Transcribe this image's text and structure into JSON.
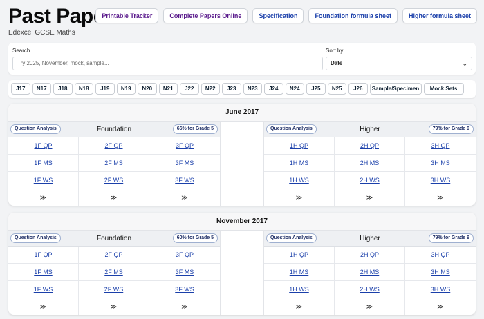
{
  "header": {
    "title": "Past Papers",
    "subtitle": "Edexcel GCSE Maths"
  },
  "top_links": [
    {
      "label": "Printable Tracker",
      "state": "visited"
    },
    {
      "label": "Complete Papers Online",
      "state": "visited"
    },
    {
      "label": "Specification",
      "state": "link"
    },
    {
      "label": "Foundation formula sheet",
      "state": "link"
    },
    {
      "label": "Higher formula sheet",
      "state": "link"
    }
  ],
  "search": {
    "label": "Search",
    "placeholder": "Try 2025, November, mock, sample..."
  },
  "sort": {
    "label": "Sort by",
    "value": "Date"
  },
  "chips": [
    "J17",
    "N17",
    "J18",
    "N18",
    "J19",
    "N19",
    "N20",
    "N21",
    "J22",
    "N22",
    "J23",
    "N23",
    "J24",
    "N24",
    "J25",
    "N25",
    "J26",
    "Sample/Specimen",
    "Mock Sets"
  ],
  "sessions": [
    {
      "title": "June 2017",
      "foundation": {
        "name": "Foundation",
        "analysis": "Question Analysis",
        "grade": "66% for Grade 5",
        "rows": [
          [
            "1F QP",
            "2F QP",
            "3F QP"
          ],
          [
            "1F MS",
            "2F MS",
            "3F MS"
          ],
          [
            "1F WS",
            "2F WS",
            "3F WS"
          ],
          [
            "≫",
            "≫",
            "≫"
          ]
        ]
      },
      "higher": {
        "name": "Higher",
        "analysis": "Question Analysis",
        "grade": "79% for Grade 9",
        "rows": [
          [
            "1H QP",
            "2H QP",
            "3H QP"
          ],
          [
            "1H MS",
            "2H MS",
            "3H MS"
          ],
          [
            "1H WS",
            "2H WS",
            "3H WS"
          ],
          [
            "≫",
            "≫",
            "≫"
          ]
        ]
      }
    },
    {
      "title": "November 2017",
      "foundation": {
        "name": "Foundation",
        "analysis": "Question Analysis",
        "grade": "60% for Grade 5",
        "rows": [
          [
            "1F QP",
            "2F QP",
            "3F QP"
          ],
          [
            "1F MS",
            "2F MS",
            "3F MS"
          ],
          [
            "1F WS",
            "2F WS",
            "3F WS"
          ],
          [
            "≫",
            "≫",
            "≫"
          ]
        ]
      },
      "higher": {
        "name": "Higher",
        "analysis": "Question Analysis",
        "grade": "79% for Grade 9",
        "rows": [
          [
            "1H QP",
            "2H QP",
            "3H QP"
          ],
          [
            "1H MS",
            "2H MS",
            "3H MS"
          ],
          [
            "1H WS",
            "2H WS",
            "3H WS"
          ],
          [
            "≫",
            "≫",
            "≫"
          ]
        ]
      }
    }
  ],
  "icons": {
    "sort_chevron": "chevron-down-icon"
  },
  "colors": {
    "link": "#1a3faa",
    "visited": "#5a1a8c",
    "background": "#f2f3f5"
  }
}
